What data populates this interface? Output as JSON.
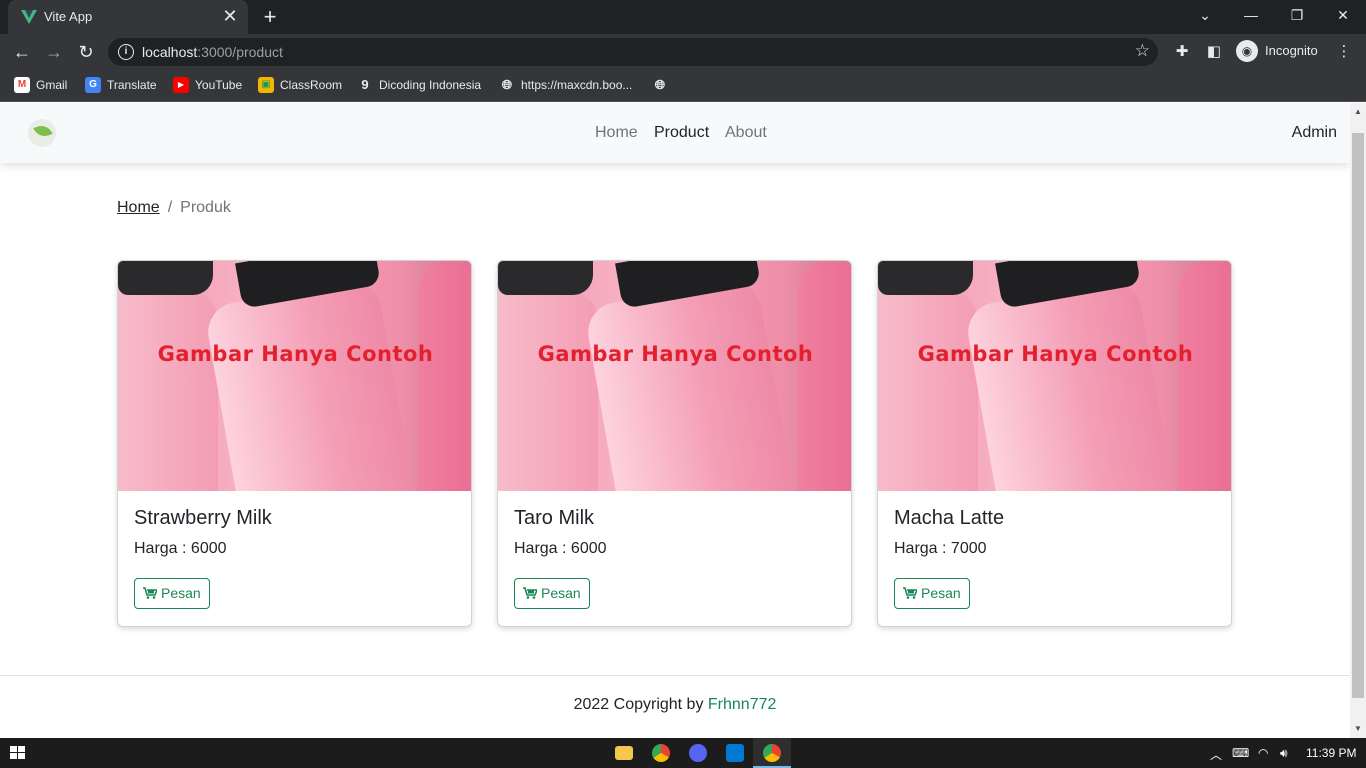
{
  "browser": {
    "tab_title": "Vite App",
    "url_host": "localhost",
    "url_path": ":3000/product",
    "profile_label": "Incognito",
    "bookmarks": [
      {
        "label": "Gmail",
        "icon": "gmail-icon"
      },
      {
        "label": "Translate",
        "icon": "translate-icon"
      },
      {
        "label": "YouTube",
        "icon": "youtube-icon"
      },
      {
        "label": "ClassRoom",
        "icon": "classroom-icon"
      },
      {
        "label": "Dicoding Indonesia",
        "icon": "dicoding-icon"
      },
      {
        "label": "https://maxcdn.boo...",
        "icon": "globe-icon"
      },
      {
        "label": "",
        "icon": "globe-icon"
      }
    ]
  },
  "navbar": {
    "links": [
      {
        "label": "Home",
        "active": false
      },
      {
        "label": "Product",
        "active": true
      },
      {
        "label": "About",
        "active": false
      }
    ],
    "user_label": "Admin"
  },
  "breadcrumb": {
    "home": "Home",
    "separator": "/",
    "current": "Produk"
  },
  "products": [
    {
      "name": "Strawberry Milk",
      "price_text": "Harga : 6000",
      "image_caption": "Gambar Hanya Contoh",
      "button_label": "Pesan"
    },
    {
      "name": "Taro Milk",
      "price_text": "Harga : 6000",
      "image_caption": "Gambar Hanya Contoh",
      "button_label": "Pesan"
    },
    {
      "name": "Macha Latte",
      "price_text": "Harga : 7000",
      "image_caption": "Gambar Hanya Contoh",
      "button_label": "Pesan"
    }
  ],
  "footer": {
    "prefix": "2022 Copyright by ",
    "link": "Frhnn772"
  },
  "taskbar": {
    "clock": "11:39 PM"
  },
  "colors": {
    "accent": "#198754",
    "caption_red": "#e3202e",
    "chrome_dark": "#202124",
    "chrome_toolbar": "#35363a"
  }
}
